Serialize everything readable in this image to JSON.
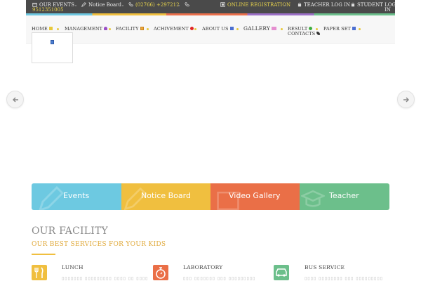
{
  "topbar": {
    "events_label": "OUR EVENTS",
    "notice_label": "Notice Board",
    "phone_label": "(02766) +297212",
    "mobile_label": "9512351005",
    "registration_label": "ONLINE REGISTRATION",
    "teacher_login_label": "TEACHER LOG IN",
    "student_login_label_line1": "STUDENT LOG",
    "student_login_label_line2": "IN"
  },
  "nav": {
    "items": [
      {
        "label": "HOME"
      },
      {
        "label": "MANAGEMENT"
      },
      {
        "label": "FACILITY"
      },
      {
        "label": "ACHIVEMENT"
      },
      {
        "label": "ABOUT US"
      },
      {
        "label": "GALLERY"
      },
      {
        "label": "RESULT"
      },
      {
        "label": "PAPER SET"
      },
      {
        "label": "CONTACTS"
      }
    ]
  },
  "tiles": [
    {
      "label": "Events",
      "color": "#6dc9e1"
    },
    {
      "label": "Notice Board",
      "color": "#f0bf3f"
    },
    {
      "label": "Video Gallery",
      "color": "#ea6f47"
    },
    {
      "label": "Teacher",
      "color": "#6cbf8b"
    }
  ],
  "facility": {
    "title": "OUR FACILITY",
    "subtitle": "OUR BEST SERVICES FOR YOUR KIDS",
    "services": [
      {
        "title": "LUNCH",
        "color": "#f0bf3f",
        "icon": "fork-knife-icon",
        "text": "▯▯▯▯▯▯▯ ▯▯▯▯▯▯▯▯▯ ▯▯▯▯ ▯▯ ▯▯▯▯"
      },
      {
        "title": "LABORATORY",
        "color": "#ea6f47",
        "icon": "stopwatch-icon",
        "text": "▯▯▯ ▯▯▯▯▯▯▯ ▯▯▯ ▯▯▯▯▯▯▯▯▯"
      },
      {
        "title": "BUS SERVICE",
        "color": "#6cbf8b",
        "icon": "bus-icon",
        "text": "▯▯▯▯ ▯▯▯▯▯▯▯▯ ▯▯▯ ▯▯▯▯▯▯▯▯▯"
      }
    ]
  },
  "colors": {
    "topbar_bg": "#4a4a4a",
    "accent_yellow": "#e8d44d"
  }
}
